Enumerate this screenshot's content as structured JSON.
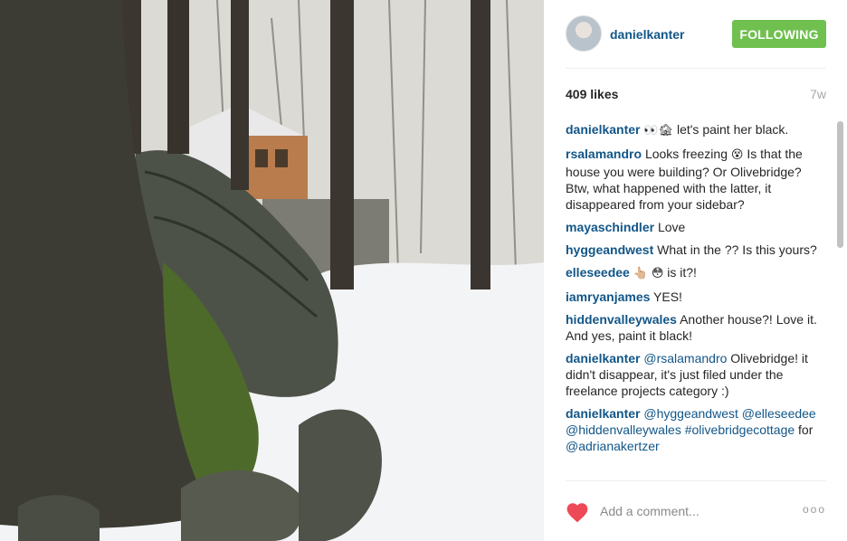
{
  "post": {
    "username": "danielkanter",
    "follow_label": "FOLLOWING",
    "likes": "409 likes",
    "age": "7w"
  },
  "comments": [
    {
      "author": "danielkanter",
      "emoji": "👀🏚",
      "text": "let's paint her black."
    },
    {
      "author": "rsalamandro",
      "text_a": "Looks freezing",
      "emoji": "😵",
      "text_b": "Is that the house you were building? Or Olivebridge? Btw, what happened with the latter, it disappeared from your sidebar?"
    },
    {
      "author": "mayaschindler",
      "text": "Love"
    },
    {
      "author": "hyggeandwest",
      "text": "What in the ?? Is this yours?"
    },
    {
      "author": "elleseedee",
      "emoji_a": "👆🏼",
      "emoji_b": "😳",
      "text": "is it?!"
    },
    {
      "author": "iamryanjames",
      "text": "YES!"
    },
    {
      "author": "hiddenvalleywales",
      "text": "Another house?! Love it. And yes, paint it black!"
    },
    {
      "author": "danielkanter",
      "mention": "@rsalamandro",
      "text": "Olivebridge! it didn't disappear, it's just filed under the freelance projects category :)"
    },
    {
      "author": "danielkanter",
      "mention_a": "@hyggeandwest",
      "mention_b": "@elleseedee",
      "mention_c": "@hiddenvalleywales",
      "hashtag": "#olivebridgecottage",
      "text_for": "for",
      "mention_d": "@adrianakertzer"
    }
  ],
  "footer": {
    "add_comment_placeholder": "Add a comment...",
    "more_label": "ooo",
    "heart_color": "#ed4956"
  },
  "colors": {
    "link": "#125688",
    "follow_bg": "#70c050"
  }
}
